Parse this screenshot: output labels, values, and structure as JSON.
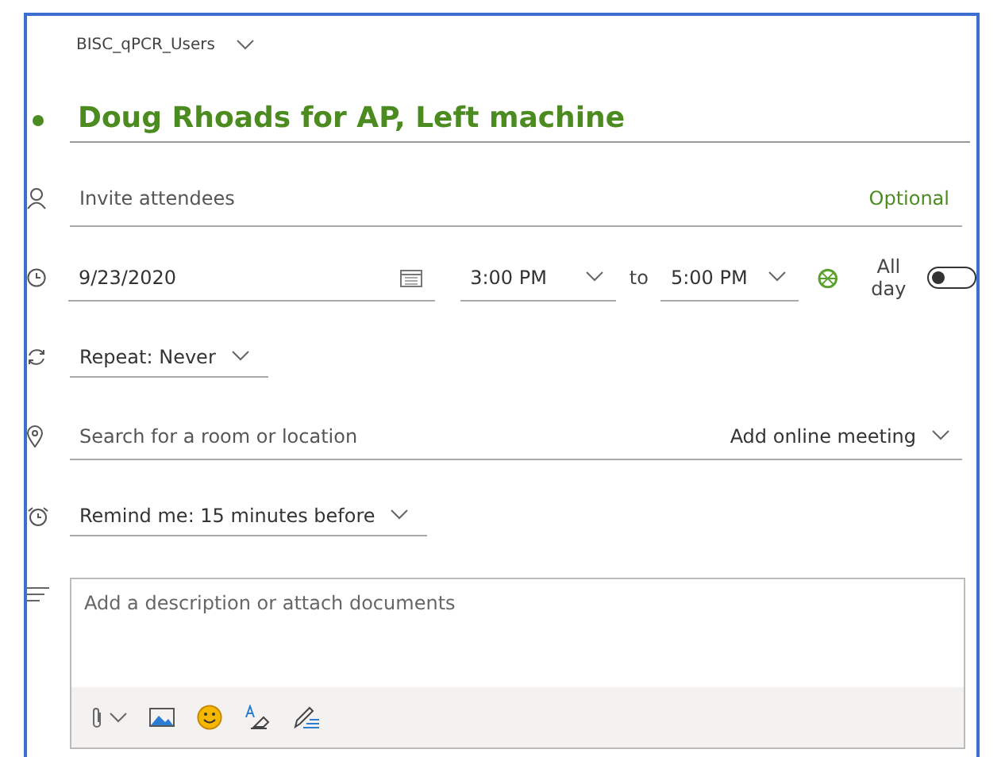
{
  "calendar": {
    "name": "BISC_qPCR_Users"
  },
  "title": "Doug Rhoads for AP, Left machine",
  "attendees": {
    "placeholder": "Invite attendees",
    "optional": "Optional"
  },
  "when": {
    "date": "9/23/2020",
    "start": "3:00 PM",
    "to": "to",
    "end": "5:00 PM",
    "all_day": {
      "label": "All day",
      "on": false
    }
  },
  "repeat": {
    "value": "Repeat:  Never"
  },
  "location": {
    "placeholder": "Search for a room or location",
    "online": "Add online meeting"
  },
  "reminder": {
    "value": "Remind me:  15 minutes before"
  },
  "description": {
    "placeholder": "Add a description or attach documents"
  }
}
